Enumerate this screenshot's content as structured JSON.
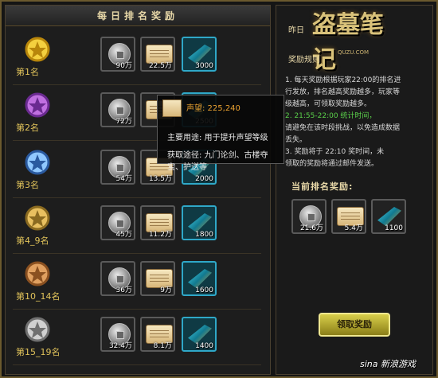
{
  "left_panel": {
    "title": "每日排名奖励"
  },
  "ranks": [
    {
      "label": "第1名",
      "rewards": [
        "90万",
        "22.5万",
        "3000"
      ]
    },
    {
      "label": "第2名",
      "rewards": [
        "72万",
        "",
        "2500"
      ]
    },
    {
      "label": "第3名",
      "rewards": [
        "54万",
        "13.5万",
        "2000"
      ]
    },
    {
      "label": "第4_9名",
      "rewards": [
        "45万",
        "11.2万",
        "1800"
      ]
    },
    {
      "label": "第10_14名",
      "rewards": [
        "36万",
        "9万",
        "1600"
      ]
    },
    {
      "label": "第15_19名",
      "rewards": [
        "32.4万",
        "8.1万",
        "1400"
      ]
    }
  ],
  "right_panel": {
    "logo_text": "盗墓笔记",
    "logo_url": "QUZU.COM",
    "yesterday_label": "昨日",
    "reward_desc_label": "奖励规则",
    "rules_lines": [
      "1. 每天奖励根据玩家22:00的排名进",
      "行发放，排名越高奖励越多，玩家等",
      "级越高，可领取奖励越多。",
      "2. 21:55-22:00 统计时间，",
      "请避免在该时段挑战，以免造成数据",
      "丢失。",
      "3. 奖励将于 22:10 奖时间，未",
      "领取的奖励将通过邮件发送。"
    ],
    "current_title": "当前排名奖励:",
    "current_rewards": [
      "21.6万",
      "5.4万",
      "1100"
    ],
    "claim_button": "领取奖励"
  },
  "tooltip": {
    "name": "声望: 225,240",
    "use": "主要用途: 用于提升声望等级",
    "source": "获取途径: 九门论剑、古楼夺宝、护送等"
  },
  "watermark": "sina 新浪游戏",
  "colors": {
    "gold": "#e0c25a",
    "highlight_green": "#5ad04a",
    "tooltip_name": "#e8a030",
    "button": "#d8cf4a"
  }
}
